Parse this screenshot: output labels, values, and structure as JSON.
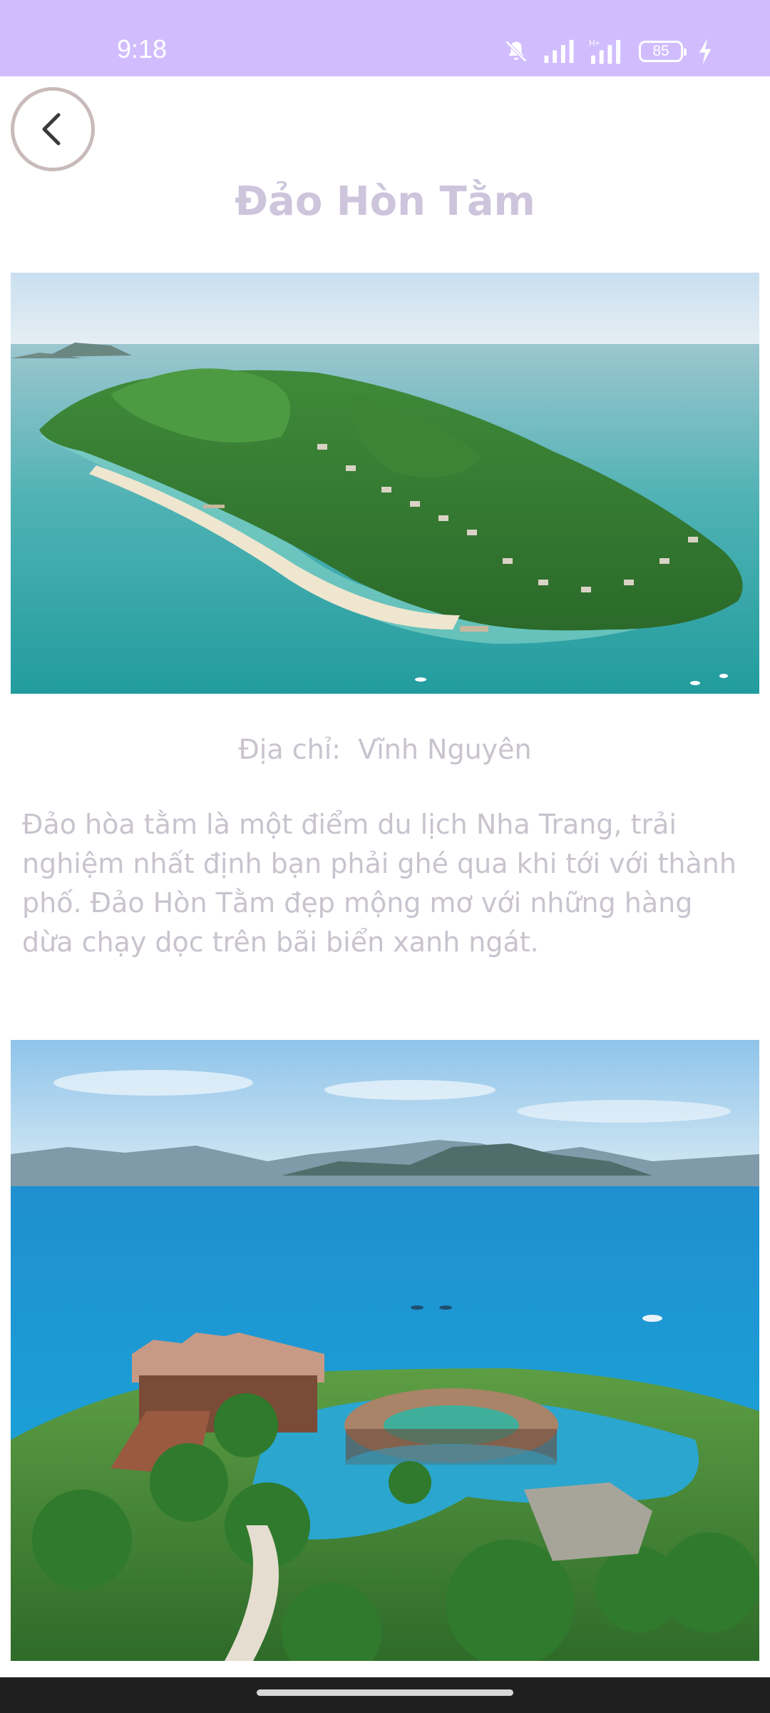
{
  "status_bar": {
    "time": "9:18",
    "battery": "85",
    "icons": [
      "bell-muted-icon",
      "signal-icon",
      "hplus-signal-icon",
      "battery-icon",
      "charging-icon"
    ],
    "background": "#d1bdfd"
  },
  "header": {
    "back_icon": "chevron-left-icon",
    "title": "Đảo Hòn Tằm"
  },
  "place": {
    "address_label": "Địa chỉ:",
    "address_value": "Vĩnh Nguyên",
    "description": "Đảo hòa tằm là một điểm du lịch Nha Trang, trải nghiệm nhất định bạn phải ghé qua khi tới với thành phố. Đảo Hòn Tằm đẹp mộng mơ với những hàng dừa chạy dọc trên bãi biển xanh ngát."
  },
  "colors": {
    "title": "#cdc5dc",
    "body_text": "#c9c3ce",
    "nav_bar": "#1f1f1f"
  }
}
